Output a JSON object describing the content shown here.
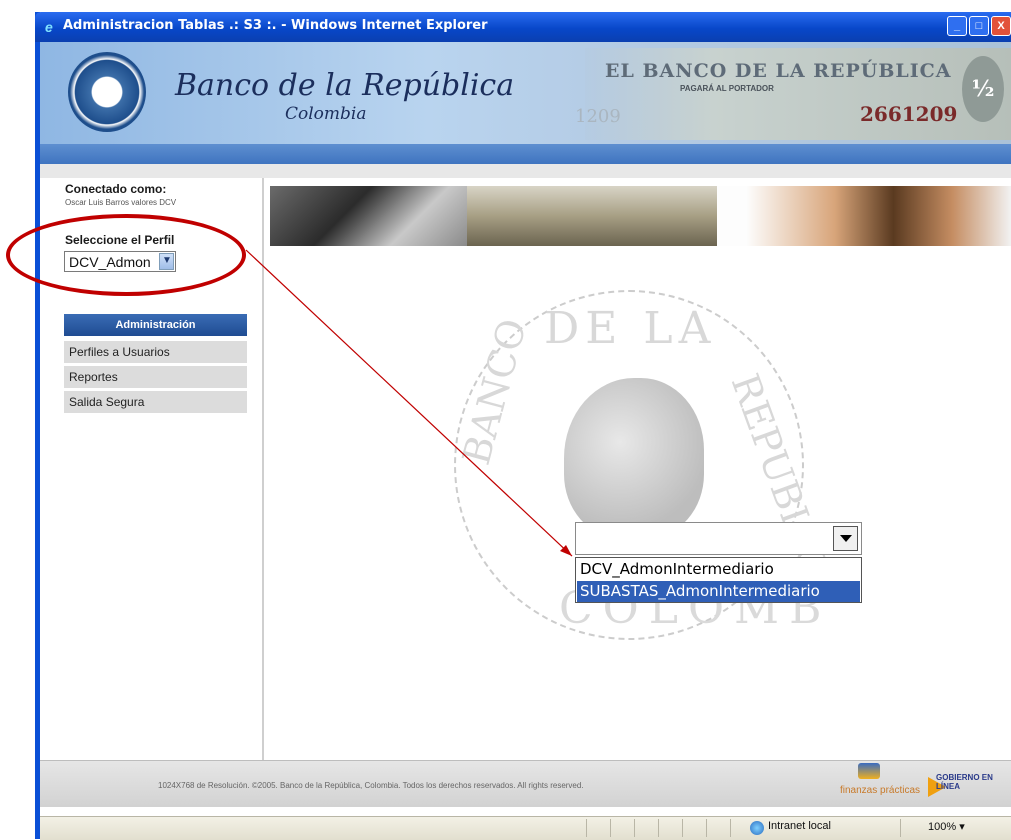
{
  "window": {
    "title": "Administracion Tablas .: S3 :. - Windows Internet Explorer",
    "minimize_glyph": "_",
    "maximize_glyph": "□",
    "close_glyph": "X"
  },
  "header": {
    "brand": "Banco de la República",
    "brand_sub": "Colombia",
    "banknote_title": "EL BANCO DE LA REPÚBLICA",
    "banknote_sub": "PAGARÁ AL PORTADOR",
    "banknote_number": "2661209",
    "banknote_faded": "1209",
    "banknote_half": "½"
  },
  "sidebar": {
    "connected_label": "Conectado como:",
    "connected_user": "Oscar Luis Barros valores DCV",
    "profile_label": "Seleccione el Perfil",
    "profile_value": "DCV_Admon",
    "menu_heading": "Administración",
    "menu_items": [
      {
        "label": "Perfiles a Usuarios"
      },
      {
        "label": "Reportes"
      },
      {
        "label": "Salida Segura"
      }
    ]
  },
  "main": {
    "watermark_top": "DE LA",
    "watermark_bottom": "COLOMB",
    "watermark_left": "BANCO",
    "watermark_right": "REPUBLICA"
  },
  "callout": {
    "combo_value": "",
    "options": [
      {
        "label": "DCV_AdmonIntermediario",
        "selected": false
      },
      {
        "label": "SUBASTAS_AdmonIntermediario",
        "selected": true
      }
    ]
  },
  "footer": {
    "text": "1024X768 de Resolución. ©2005. Banco de la República, Colombia. Todos los derechos reservados. All rights reserved.",
    "logo_finanzas": "finanzas prácticas",
    "logo_gobierno": "GOBIERNO EN LÍNEA"
  },
  "statusbar": {
    "zone": "Intranet local",
    "zoom": "100%",
    "zoom_arrow": "▾"
  },
  "colors": {
    "annotation_red": "#c00000",
    "menu_blue": "#1f4c92",
    "selected_option": "#2f5fb7"
  }
}
